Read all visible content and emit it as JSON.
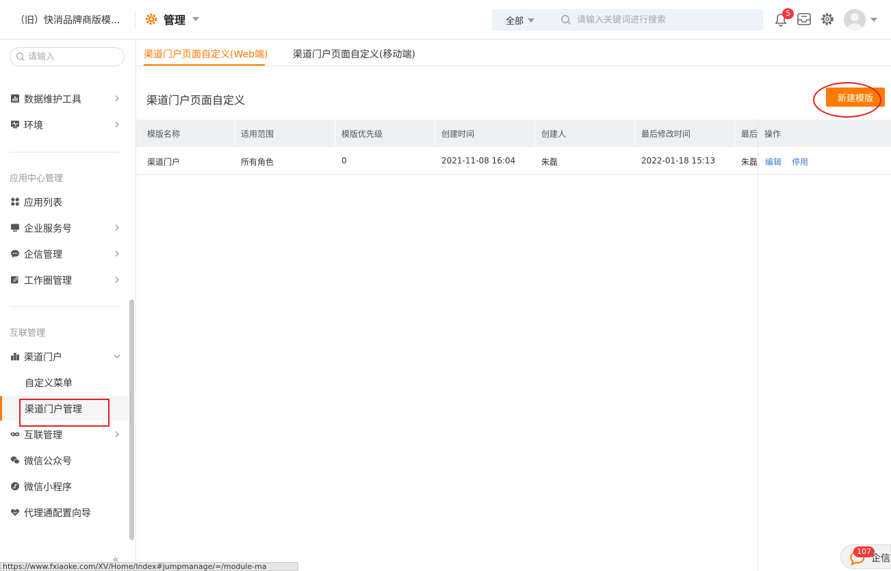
{
  "header": {
    "org_name": "（旧）快消品牌商版模...",
    "app_title": "管理",
    "search_scope": "全部",
    "search_placeholder": "请输入关键词进行搜索",
    "notification_count": "5"
  },
  "sidebar": {
    "search_placeholder": "请输入",
    "items_top": [
      {
        "label": "数据维护工具"
      },
      {
        "label": "环境"
      }
    ],
    "group_app": "应用中心管理",
    "items_app": [
      {
        "label": "应用列表"
      },
      {
        "label": "企业服务号"
      },
      {
        "label": "企信管理"
      },
      {
        "label": "工作圈管理"
      }
    ],
    "group_interconnect": "互联管理",
    "items_interconnect": [
      {
        "label": "渠道门户"
      },
      {
        "label": "自定义菜单"
      },
      {
        "label": "渠道门户管理"
      },
      {
        "label": "互联管理"
      },
      {
        "label": "微信公众号"
      },
      {
        "label": "微信小程序"
      },
      {
        "label": "代理通配置向导"
      }
    ],
    "collapse_label": "«"
  },
  "main": {
    "tabs": [
      {
        "label": "渠道门户页面自定义(Web端)"
      },
      {
        "label": "渠道门户页面自定义(移动端)"
      }
    ],
    "panel_title": "渠道门户页面自定义",
    "new_button": "新建模版",
    "table": {
      "columns": [
        "模版名称",
        "适用范围",
        "模版优先级",
        "创建时间",
        "创建人",
        "最后修改时间",
        "最后",
        "操作"
      ],
      "rows": [
        [
          "渠道门户",
          "所有角色",
          "0",
          "2021-11-08 16:04",
          "朱磊",
          "2022-01-18 15:13",
          "朱磊"
        ]
      ],
      "actions": [
        "编辑",
        "停用"
      ]
    }
  },
  "status_url": "https://www.fxiaoke.com/XV/Home/Index#jumpmanage/=/module-ma",
  "chat_float": {
    "badge": "107",
    "label": "企信"
  },
  "colors": {
    "accent": "#ff7a00",
    "link": "#3b7dd8",
    "annotation": "#e02020",
    "badge": "#f23a3a"
  }
}
